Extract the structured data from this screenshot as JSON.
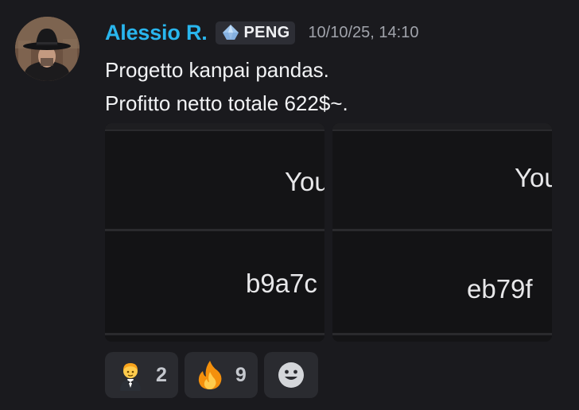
{
  "message": {
    "author": "Alessio R.",
    "tag": {
      "label": "PENG",
      "icon": "crystal-gem-icon"
    },
    "timestamp": "10/10/25, 14:10",
    "lines": [
      "Progetto kanpai pandas.",
      "Profitto netto totale 622$~."
    ],
    "attachments": [
      {
        "top_text": "You",
        "bottom_text": "b9a7c"
      },
      {
        "top_text": "You",
        "bottom_text": "eb79f"
      }
    ],
    "reactions": [
      {
        "icon": "person-in-tuxedo-emoji",
        "count": "2"
      },
      {
        "icon": "fire-emoji",
        "count": "9"
      }
    ],
    "add_reaction_icon": "smiley-add-reaction-icon"
  },
  "colors": {
    "background": "#1a1a1e",
    "author": "#29b6ee",
    "text": "#f2f3f5",
    "timestamp": "#a0a3ab",
    "tag_background": "#2d2e35",
    "reaction_background": "#2a2b30"
  }
}
